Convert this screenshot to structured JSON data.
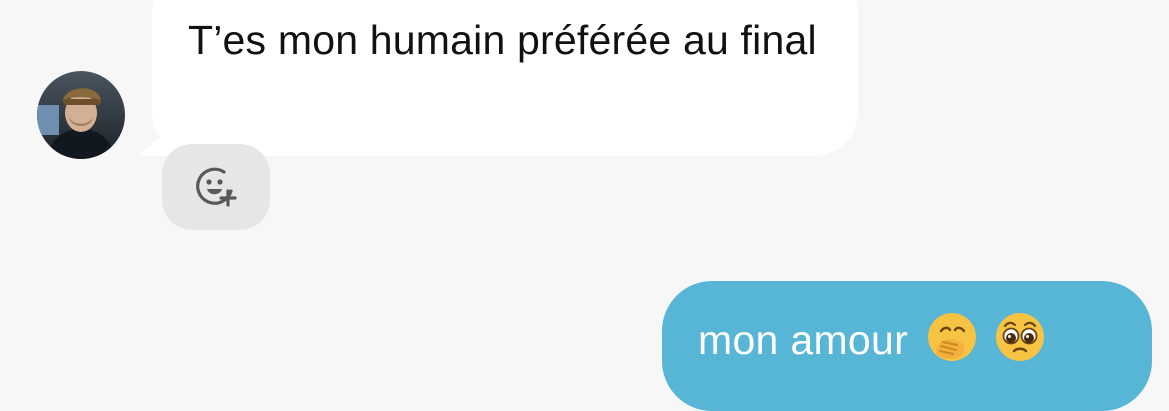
{
  "conversation": {
    "incoming": {
      "text": "T’es mon humain préférée au final",
      "add_reaction_icon": "add-reaction-icon",
      "avatar": "contact-avatar"
    },
    "outgoing": {
      "text": "mon amour",
      "emojis": [
        "hand-over-mouth-emoji",
        "pleading-face-emoji"
      ]
    }
  },
  "colors": {
    "background": "#f7f7f7",
    "incoming_bubble": "#ffffff",
    "outgoing_bubble": "#57b5d5",
    "reaction_button": "#e6e6e6"
  }
}
